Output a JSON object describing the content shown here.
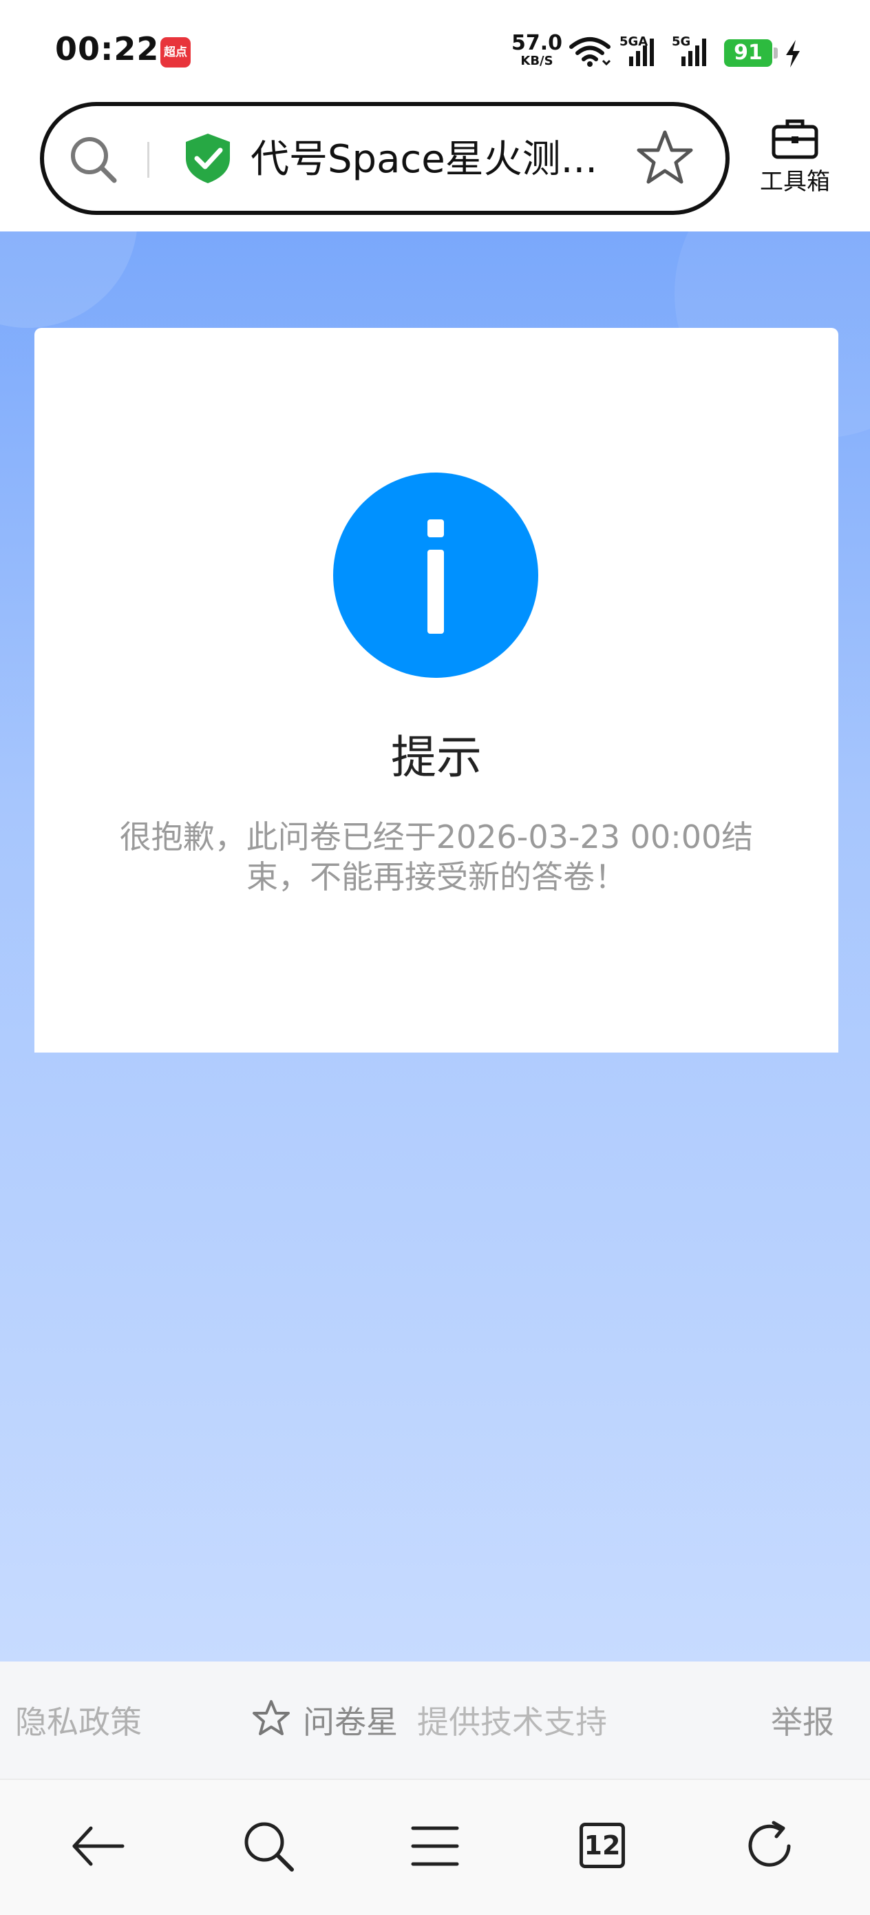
{
  "status_bar": {
    "time": "00:22",
    "app_badge": "超点",
    "net_speed": "57.0",
    "net_unit": "KB/S",
    "signal1_label": "5GA",
    "signal2_label": "5G",
    "battery": "91"
  },
  "address_bar": {
    "title": "代号Space星火测..."
  },
  "toolbar": {
    "toolbox_label": "工具箱"
  },
  "card": {
    "title": "提示",
    "message": "很抱歉，此问卷已经于2026-03-23 00:00结束，不能再接受新的答卷！"
  },
  "footer": {
    "privacy": "隐私政策",
    "brand": "问卷星",
    "support": "提供技术支持",
    "report": "举报"
  },
  "bottom_nav": {
    "tab_count": "12"
  },
  "colors": {
    "info_blue": "#0091ff",
    "battery_green": "#2dbb3f",
    "shield_green": "#27a844",
    "bg_top": "#7aa8fb",
    "bg_bottom": "#c7dbff"
  }
}
